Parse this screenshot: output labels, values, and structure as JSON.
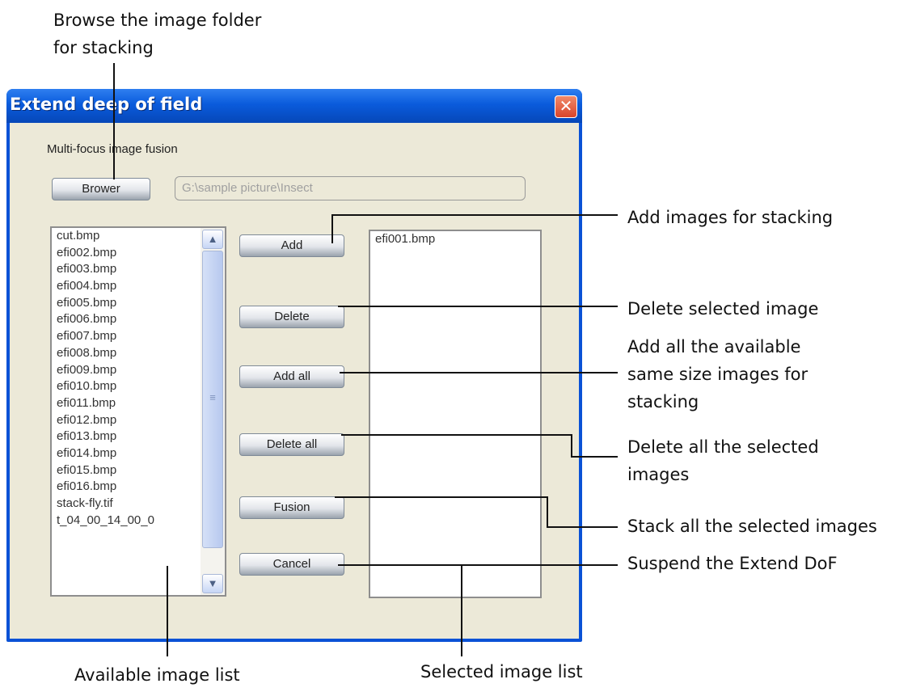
{
  "dialog": {
    "title": "Extend deep of field",
    "close_glyph": "✕",
    "subtitle": "Multi-focus image fusion",
    "browse_label": "Brower",
    "path_value": "G:\\sample picture\\Insect",
    "buttons": {
      "add": "Add",
      "delete": "Delete",
      "add_all": "Add all",
      "delete_all": "Delete all",
      "fusion": "Fusion",
      "cancel": "Cancel"
    },
    "available_images": [
      "cut.bmp",
      "efi002.bmp",
      "efi003.bmp",
      "efi004.bmp",
      "efi005.bmp",
      "efi006.bmp",
      "efi007.bmp",
      "efi008.bmp",
      "efi009.bmp",
      "efi010.bmp",
      "efi011.bmp",
      "efi012.bmp",
      "efi013.bmp",
      "efi014.bmp",
      "efi015.bmp",
      "efi016.bmp",
      "stack-fly.tif",
      "t_04_00_14_00_0"
    ],
    "selected_images": [
      "efi001.bmp"
    ],
    "scroll_up_icon": "chevron-up-icon",
    "scroll_down_icon": "chevron-down-icon"
  },
  "annotations": {
    "browse": [
      "Browse the image folder",
      "for stacking"
    ],
    "add": "Add images for stacking",
    "delete": "Delete selected image",
    "add_all": [
      "Add all the available",
      "same size images for",
      "stacking"
    ],
    "delete_all": [
      "Delete all the selected",
      "images"
    ],
    "fusion": "Stack all the selected images",
    "cancel": "Suspend the Extend DoF",
    "available": "Available image list",
    "selected": "Selected image list"
  }
}
